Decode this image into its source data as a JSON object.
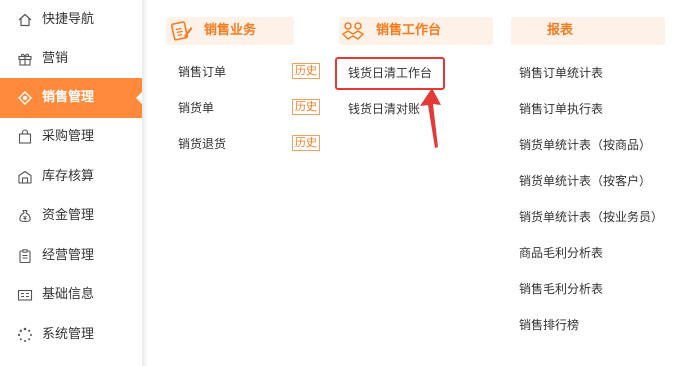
{
  "sidebar": {
    "items": [
      {
        "label": "快捷导航",
        "icon": "home-icon",
        "active": false
      },
      {
        "label": "营销",
        "icon": "gift-icon",
        "active": false
      },
      {
        "label": "销售管理",
        "icon": "sales-diamond-icon",
        "active": true
      },
      {
        "label": "采购管理",
        "icon": "shopping-bag-icon",
        "active": false
      },
      {
        "label": "库存核算",
        "icon": "warehouse-icon",
        "active": false
      },
      {
        "label": "资金管理",
        "icon": "money-bag-icon",
        "active": false
      },
      {
        "label": "经营管理",
        "icon": "clipboard-icon",
        "active": false
      },
      {
        "label": "基础信息",
        "icon": "id-card-icon",
        "active": false
      },
      {
        "label": "系统管理",
        "icon": "loading-circle-icon",
        "active": false
      }
    ],
    "active_color": "#ff8a3c"
  },
  "sales_business": {
    "title": "销售业务",
    "icon": "document-pen-icon",
    "items": [
      {
        "label": "销售订单",
        "history": "历史"
      },
      {
        "label": "销货单",
        "history": "历史"
      },
      {
        "label": "销货退货",
        "history": "历史"
      }
    ]
  },
  "sales_workbench": {
    "title": "销售工作台",
    "icon": "handshake-icon",
    "items": [
      {
        "label": "钱货日清工作台"
      },
      {
        "label": "钱货日清对账"
      }
    ]
  },
  "reports": {
    "title": "报表",
    "items": [
      {
        "label": "销售订单统计表"
      },
      {
        "label": "销售订单执行表"
      },
      {
        "label": "销货单统计表（按商品）"
      },
      {
        "label": "销货单统计表（按客户）"
      },
      {
        "label": "销货单统计表（按业务员）"
      },
      {
        "label": "商品毛利分析表"
      },
      {
        "label": "销售毛利分析表"
      },
      {
        "label": "销售排行榜"
      }
    ]
  },
  "colors": {
    "accent": "#f47c20",
    "header_bg": "#fdf1e8",
    "annotation_red": "#e53935"
  }
}
